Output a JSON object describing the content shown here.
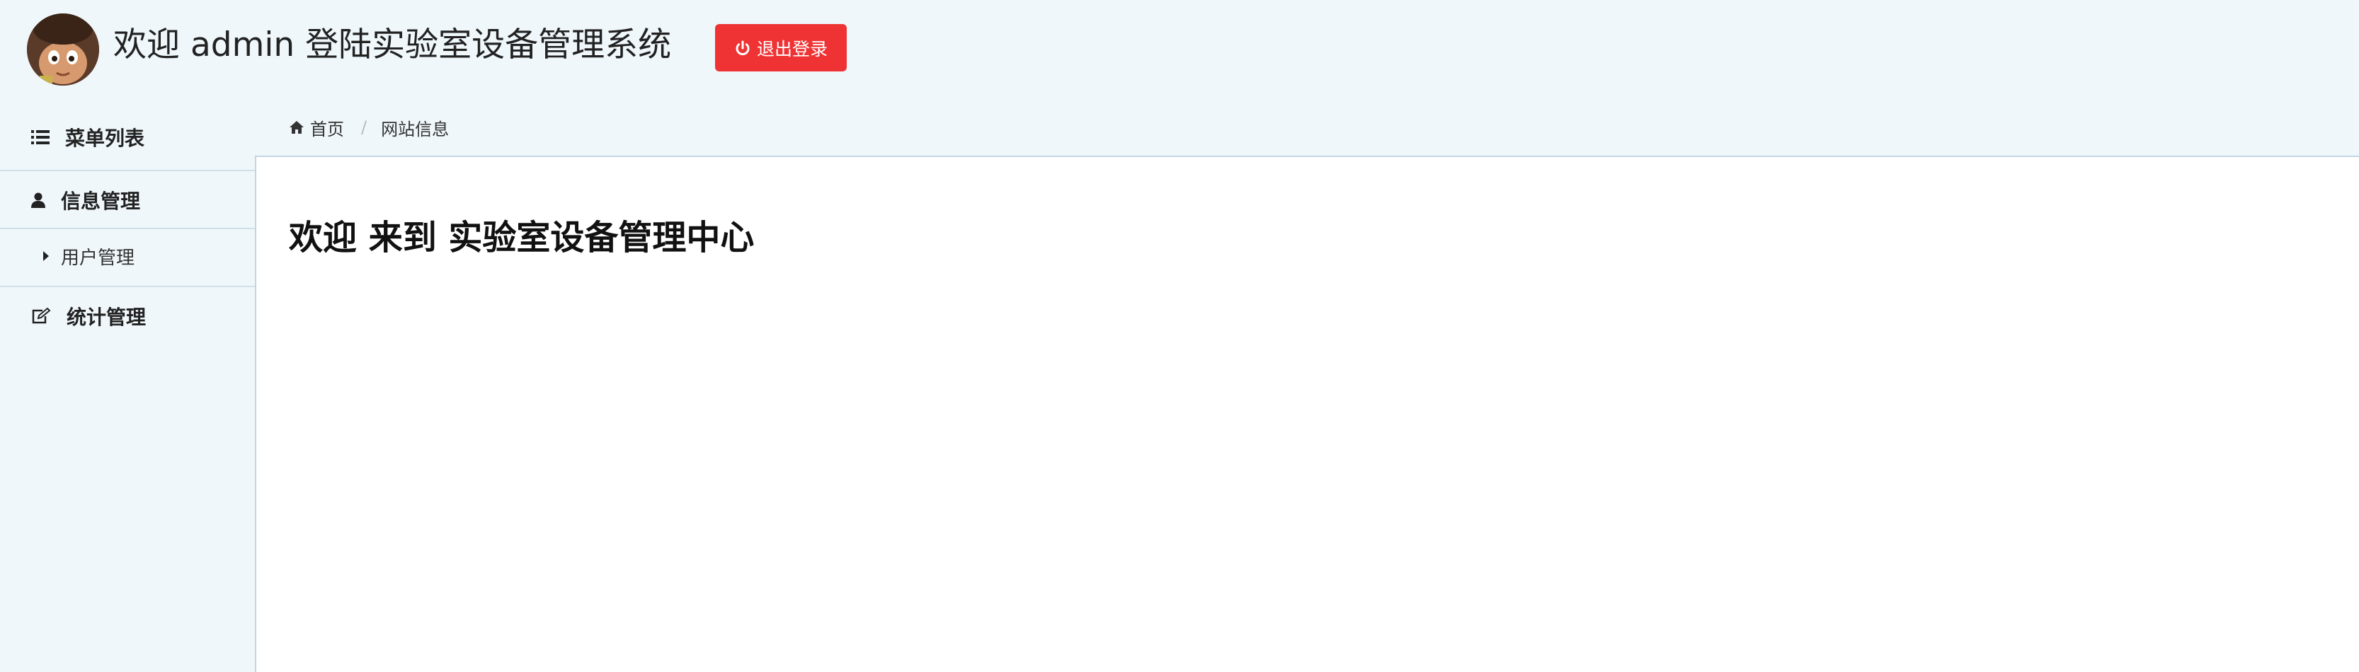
{
  "header": {
    "title": "欢迎 admin 登陆实验室设备管理系统",
    "logout_label": "退出登录",
    "logout_color": "#ef3334"
  },
  "sidebar": {
    "menu_title": "菜单列表",
    "sections": [
      {
        "label": "信息管理",
        "icon": "user-icon",
        "items": [
          {
            "label": "用户管理"
          }
        ]
      },
      {
        "label": "统计管理",
        "icon": "edit-icon",
        "items": []
      }
    ]
  },
  "breadcrumb": {
    "home_label": "首页",
    "current_label": "网站信息"
  },
  "main": {
    "welcome_text": "欢迎 来到 实验室设备管理中心"
  }
}
